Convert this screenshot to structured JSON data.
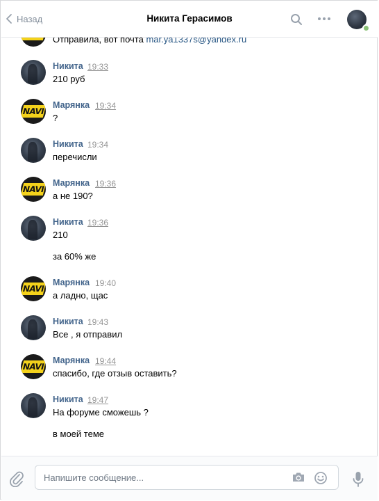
{
  "header": {
    "back_label": "Назад",
    "title": "Никита Герасимов"
  },
  "messages": [
    {
      "text": "Отправила, вот почта ",
      "email": "mar.ya1337s@yandex.ru"
    },
    {
      "author": "Никита",
      "time": "19:33",
      "text": "210 руб"
    },
    {
      "author": "Марянка",
      "time": "19:34",
      "text": "?"
    },
    {
      "author": "Никита",
      "time": "19:34",
      "text": "перечисли"
    },
    {
      "author": "Марянка",
      "time": "19:36",
      "text": "а не 190?"
    },
    {
      "author": "Никита",
      "time": "19:36",
      "text": "210",
      "text2": "за 60% же"
    },
    {
      "author": "Марянка",
      "time": "19:40",
      "text": "а ладно, щас"
    },
    {
      "author": "Никита",
      "time": "19:43",
      "text": "Все , я отправил"
    },
    {
      "author": "Марянка",
      "time": "19:44",
      "text": "спасибо, где отзыв оставить?"
    },
    {
      "author": "Никита",
      "time": "19:47",
      "text": "На форуме сможешь ?",
      "text2": "в моей теме"
    }
  ],
  "composer": {
    "placeholder": "Напишите сообщение..."
  },
  "avatar_logo_text": "NAVI",
  "colors": {
    "author": "#42648b",
    "link": "#2a5885",
    "online": "#8ac176"
  }
}
